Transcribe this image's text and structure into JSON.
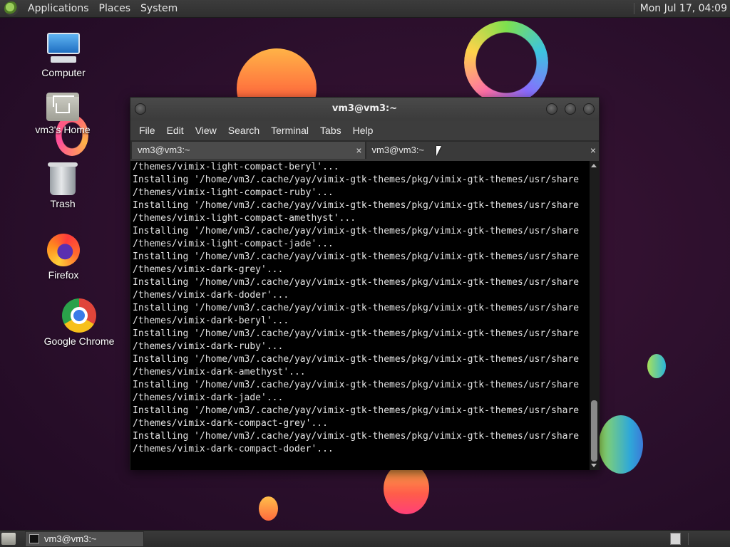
{
  "top_panel": {
    "menus": [
      "Applications",
      "Places",
      "System"
    ],
    "clock": "Mon Jul 17, 04:09"
  },
  "desktop_icons": [
    {
      "label": "Computer",
      "icon": "computer-icon"
    },
    {
      "label": "vm3's Home",
      "icon": "home-folder-icon"
    },
    {
      "label": "Trash",
      "icon": "trash-icon"
    },
    {
      "label": "Firefox",
      "icon": "firefox-icon"
    },
    {
      "label": "Google Chrome",
      "icon": "chrome-icon"
    }
  ],
  "terminal": {
    "title": "vm3@vm3:~",
    "menu": [
      "File",
      "Edit",
      "View",
      "Search",
      "Terminal",
      "Tabs",
      "Help"
    ],
    "tabs": [
      {
        "label": "vm3@vm3:~",
        "close": "×"
      },
      {
        "label": "vm3@vm3:~",
        "close": "×"
      }
    ],
    "lines": [
      "/themes/vimix-light-compact-beryl'...",
      "Installing '/home/vm3/.cache/yay/vimix-gtk-themes/pkg/vimix-gtk-themes/usr/share",
      "/themes/vimix-light-compact-ruby'...",
      "Installing '/home/vm3/.cache/yay/vimix-gtk-themes/pkg/vimix-gtk-themes/usr/share",
      "/themes/vimix-light-compact-amethyst'...",
      "Installing '/home/vm3/.cache/yay/vimix-gtk-themes/pkg/vimix-gtk-themes/usr/share",
      "/themes/vimix-light-compact-jade'...",
      "Installing '/home/vm3/.cache/yay/vimix-gtk-themes/pkg/vimix-gtk-themes/usr/share",
      "/themes/vimix-dark-grey'...",
      "Installing '/home/vm3/.cache/yay/vimix-gtk-themes/pkg/vimix-gtk-themes/usr/share",
      "/themes/vimix-dark-doder'...",
      "Installing '/home/vm3/.cache/yay/vimix-gtk-themes/pkg/vimix-gtk-themes/usr/share",
      "/themes/vimix-dark-beryl'...",
      "Installing '/home/vm3/.cache/yay/vimix-gtk-themes/pkg/vimix-gtk-themes/usr/share",
      "/themes/vimix-dark-ruby'...",
      "Installing '/home/vm3/.cache/yay/vimix-gtk-themes/pkg/vimix-gtk-themes/usr/share",
      "/themes/vimix-dark-amethyst'...",
      "Installing '/home/vm3/.cache/yay/vimix-gtk-themes/pkg/vimix-gtk-themes/usr/share",
      "/themes/vimix-dark-jade'...",
      "Installing '/home/vm3/.cache/yay/vimix-gtk-themes/pkg/vimix-gtk-themes/usr/share",
      "/themes/vimix-dark-compact-grey'...",
      "Installing '/home/vm3/.cache/yay/vimix-gtk-themes/pkg/vimix-gtk-themes/usr/share",
      "/themes/vimix-dark-compact-doder'..."
    ]
  },
  "bottom_panel": {
    "task_label": "vm3@vm3:~"
  },
  "colors": {
    "terminal_bg": "#000000",
    "terminal_fg": "#e4e4e4",
    "desktop_bg": "#2b0f2c"
  }
}
